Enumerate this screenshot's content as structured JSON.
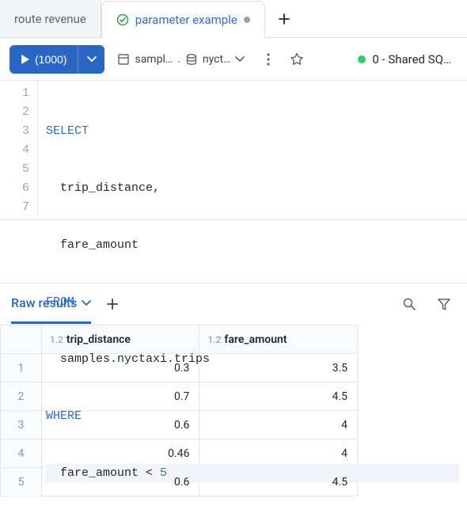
{
  "tabs": {
    "inactive_label": "route revenue",
    "active_label": "parameter example"
  },
  "toolbar": {
    "run_label": "(1000)",
    "catalog_part1": "sampl…",
    "catalog_part2": "nyct…",
    "warehouse_label": "0 - Shared SQ…"
  },
  "sql": {
    "lines": [
      {
        "n": "1",
        "kw": "SELECT",
        "rest": ""
      },
      {
        "n": "2",
        "indent": "  ",
        "rest": "trip_distance,"
      },
      {
        "n": "3",
        "indent": "  ",
        "rest": "fare_amount"
      },
      {
        "n": "4",
        "kw": "FROM",
        "rest": ""
      },
      {
        "n": "5",
        "indent": "  ",
        "rest": "samples.nyctaxi.trips"
      },
      {
        "n": "6",
        "kw": "WHERE",
        "rest": ""
      },
      {
        "n": "7",
        "indent": "  ",
        "rest_pre": "fare_amount < ",
        "num": "5"
      }
    ]
  },
  "results": {
    "tab_label": "Raw results",
    "columns": [
      {
        "dtype": "1.2",
        "name": "trip_distance"
      },
      {
        "dtype": "1.2",
        "name": "fare_amount"
      }
    ],
    "rows": [
      {
        "n": "1",
        "c0": "0.3",
        "c1": "3.5"
      },
      {
        "n": "2",
        "c0": "0.7",
        "c1": "4.5"
      },
      {
        "n": "3",
        "c0": "0.6",
        "c1": "4"
      },
      {
        "n": "4",
        "c0": "0.46",
        "c1": "4"
      },
      {
        "n": "5",
        "c0": "0.6",
        "c1": "4.5"
      }
    ]
  },
  "chart_data": {
    "type": "table",
    "columns": [
      "trip_distance",
      "fare_amount"
    ],
    "rows": [
      [
        0.3,
        3.5
      ],
      [
        0.7,
        4.5
      ],
      [
        0.6,
        4
      ],
      [
        0.46,
        4
      ],
      [
        0.6,
        4.5
      ]
    ]
  }
}
